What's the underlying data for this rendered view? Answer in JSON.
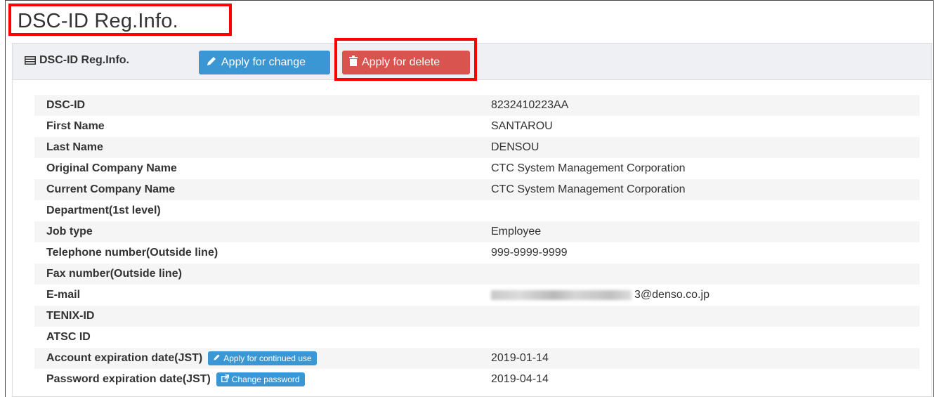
{
  "page": {
    "title": "DSC-ID Reg.Info."
  },
  "panel": {
    "title": "DSC-ID Reg.Info.",
    "icon": "list-icon",
    "apply_change_label": "Apply for change",
    "apply_delete_label": "Apply for delete"
  },
  "fields": [
    {
      "label": "DSC-ID",
      "value": "8232410223AA"
    },
    {
      "label": "First Name",
      "value": "SANTAROU"
    },
    {
      "label": "Last Name",
      "value": "DENSOU"
    },
    {
      "label": "Original Company Name",
      "value": "CTC System Management Corporation"
    },
    {
      "label": "Current Company Name",
      "value": "CTC System Management Corporation"
    },
    {
      "label": "Department(1st level)",
      "value": ""
    },
    {
      "label": "Job type",
      "value": "Employee"
    },
    {
      "label": "Telephone number(Outside line)",
      "value": "999-9999-9999"
    },
    {
      "label": "Fax number(Outside line)",
      "value": ""
    },
    {
      "label": "E-mail",
      "value": "3@denso.co.jp"
    },
    {
      "label": "TENIX-ID",
      "value": ""
    },
    {
      "label": "ATSC ID",
      "value": ""
    },
    {
      "label": "Account expiration date(JST)",
      "value": "2019-01-14",
      "action": "Apply for continued use"
    },
    {
      "label": "Password expiration date(JST)",
      "value": "2019-04-14",
      "action": "Change password"
    }
  ],
  "colors": {
    "primary": "#3a97d4",
    "danger": "#d9534f",
    "highlight": "#ff0000"
  }
}
